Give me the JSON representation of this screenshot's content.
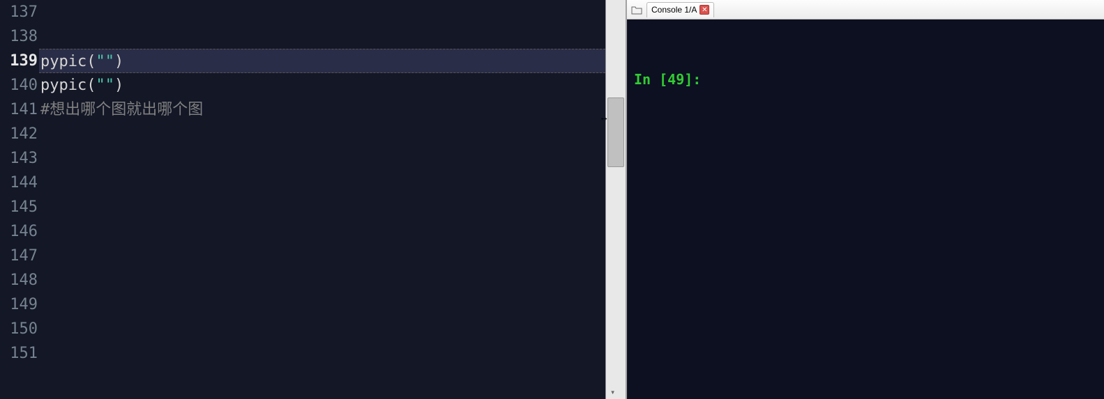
{
  "editor": {
    "active_line": 139,
    "lines": [
      {
        "num": "137",
        "content": ""
      },
      {
        "num": "138",
        "content": ""
      },
      {
        "num": "139",
        "segments": [
          {
            "t": "func",
            "v": "pypic"
          },
          {
            "t": "paren",
            "v": "("
          },
          {
            "t": "str",
            "v": "\"\""
          },
          {
            "t": "paren",
            "v": ")"
          }
        ],
        "active": true
      },
      {
        "num": "140",
        "segments": [
          {
            "t": "func",
            "v": "pypic"
          },
          {
            "t": "paren",
            "v": "("
          },
          {
            "t": "str",
            "v": "\"\""
          },
          {
            "t": "paren",
            "v": ")"
          }
        ]
      },
      {
        "num": "141",
        "segments": [
          {
            "t": "comment",
            "v": "#想出哪个图就出哪个图"
          }
        ]
      },
      {
        "num": "142",
        "content": ""
      },
      {
        "num": "143",
        "content": ""
      },
      {
        "num": "144",
        "content": ""
      },
      {
        "num": "145",
        "content": ""
      },
      {
        "num": "146",
        "content": ""
      },
      {
        "num": "147",
        "content": ""
      },
      {
        "num": "148",
        "content": ""
      },
      {
        "num": "149",
        "content": ""
      },
      {
        "num": "150",
        "content": ""
      },
      {
        "num": "151",
        "content": ""
      }
    ]
  },
  "console": {
    "tab_label": "Console 1/A",
    "prompt_in": "In [",
    "prompt_num": "49",
    "prompt_close": "]:"
  }
}
